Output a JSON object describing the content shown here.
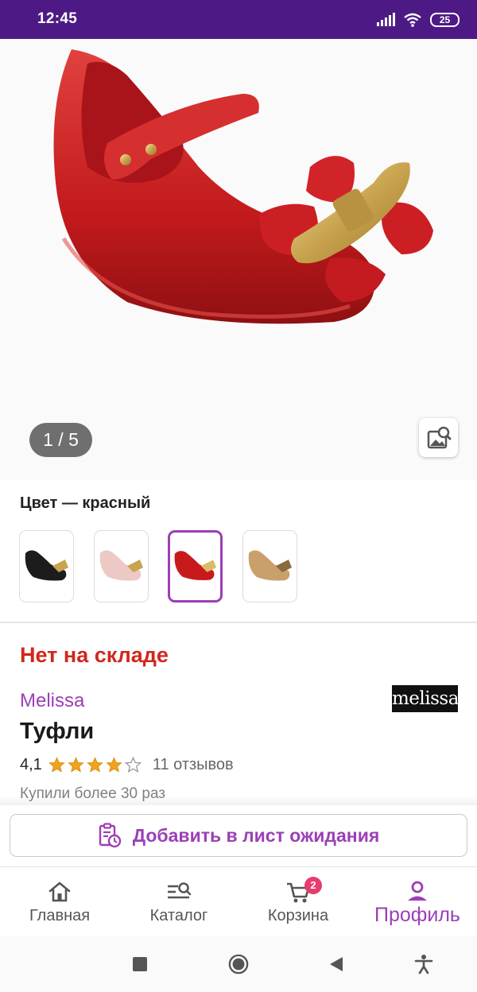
{
  "status_bar": {
    "time": "12:45",
    "battery": "25",
    "icons": [
      "signal-icon",
      "wifi-icon",
      "battery-icon"
    ]
  },
  "gallery": {
    "counter": "1 / 5",
    "current_image": 1,
    "total_images": 5,
    "search_icon": "image-search-icon"
  },
  "product": {
    "color_label": "Цвет — красный",
    "colors": [
      {
        "name": "black",
        "hex": "#1c1c1c",
        "selected": false
      },
      {
        "name": "pink",
        "hex": "#ecc9c4",
        "selected": false
      },
      {
        "name": "red",
        "hex": "#c81a1c",
        "selected": true
      },
      {
        "name": "gold",
        "hex": "#c9a06b",
        "selected": false
      }
    ],
    "stock_status": "Нет на складе",
    "brand": "Melissa",
    "brand_logo_text": "melissa",
    "title": "Туфли",
    "rating": "4,1",
    "rating_stars": 4,
    "rating_max": 5,
    "reviews": "11 отзывов",
    "bought": "Купили более 30 раз"
  },
  "wishlist_button": {
    "label": "Добавить в лист ожидания",
    "icon": "clipboard-clock-icon"
  },
  "bottom_nav": {
    "items": [
      {
        "label": "Главная",
        "icon": "home-icon"
      },
      {
        "label": "Каталог",
        "icon": "catalog-search-icon"
      },
      {
        "label": "Корзина",
        "icon": "cart-icon",
        "badge": "2"
      },
      {
        "label": "Профиль",
        "icon": "profile-icon",
        "active": true
      }
    ]
  },
  "system_nav": [
    "recents-square-icon",
    "home-circle-icon",
    "back-triangle-icon",
    "accessibility-icon"
  ],
  "colors": {
    "status_bar": "#4d1a85",
    "accent": "#9c3fb5",
    "out_of_stock": "#d0271d",
    "badge": "#e63c6e",
    "star": "#f0a31c"
  }
}
